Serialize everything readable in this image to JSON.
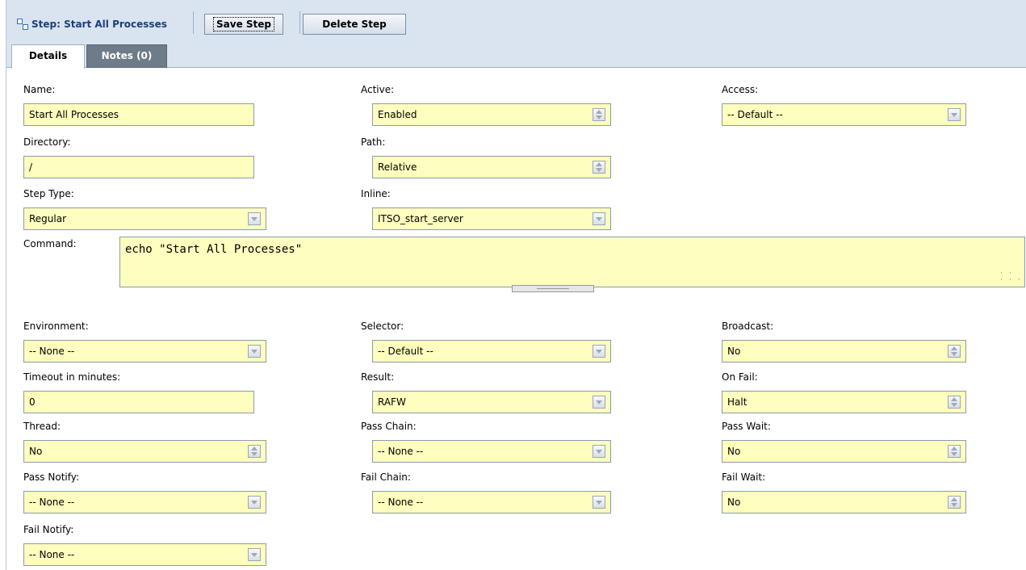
{
  "header": {
    "title": "Step: Start All Processes",
    "title_icon": "step-icon",
    "save_label": "Save Step",
    "delete_label": "Delete Step"
  },
  "tabs": [
    {
      "label": "Details",
      "active": true
    },
    {
      "label": "Notes (0)",
      "active": false
    }
  ],
  "colors": {
    "field_bg": "#fefebe",
    "header_bg": "#d9e4f0",
    "title_color": "#1c3f7a",
    "inactive_tab_bg": "#6e7b88"
  },
  "form": {
    "name": {
      "label": "Name:",
      "value": "Start All Processes"
    },
    "active": {
      "label": "Active:",
      "value": "Enabled"
    },
    "access": {
      "label": "Access:",
      "value": "-- Default --"
    },
    "directory": {
      "label": "Directory:",
      "value": "/"
    },
    "path": {
      "label": "Path:",
      "value": "Relative"
    },
    "step_type": {
      "label": "Step Type:",
      "value": "Regular"
    },
    "inline": {
      "label": "Inline:",
      "value": "ITSO_start_server"
    },
    "command": {
      "label": "Command:",
      "value": "echo \"Start All Processes\""
    },
    "environment": {
      "label": "Environment:",
      "value": "-- None --"
    },
    "selector": {
      "label": "Selector:",
      "value": "-- Default --"
    },
    "broadcast": {
      "label": "Broadcast:",
      "value": "No"
    },
    "timeout": {
      "label": "Timeout in minutes:",
      "value": "0"
    },
    "result": {
      "label": "Result:",
      "value": "RAFW"
    },
    "on_fail": {
      "label": "On Fail:",
      "value": "Halt"
    },
    "thread": {
      "label": "Thread:",
      "value": "No"
    },
    "pass_chain": {
      "label": "Pass Chain:",
      "value": "-- None --"
    },
    "pass_wait": {
      "label": "Pass Wait:",
      "value": "No"
    },
    "pass_notify": {
      "label": "Pass Notify:",
      "value": "-- None --"
    },
    "fail_chain": {
      "label": "Fail Chain:",
      "value": "-- None --"
    },
    "fail_wait": {
      "label": "Fail Wait:",
      "value": "No"
    },
    "fail_notify": {
      "label": "Fail Notify:",
      "value": "-- None --"
    }
  }
}
